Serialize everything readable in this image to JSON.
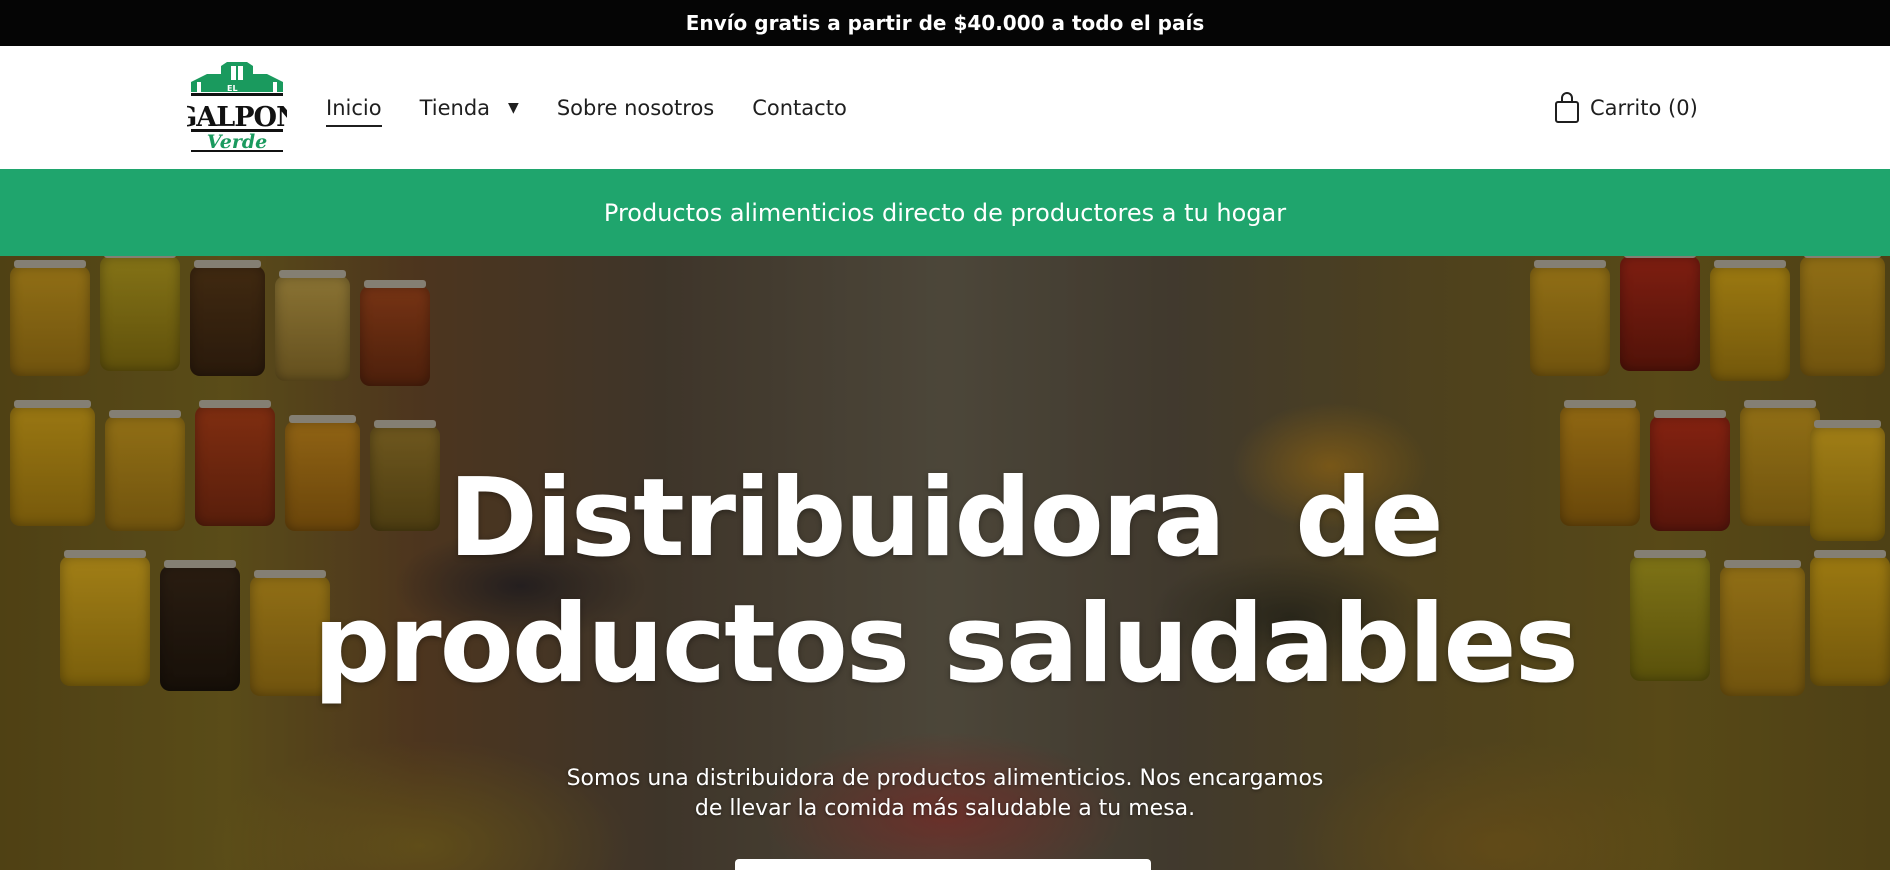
{
  "topbar": {
    "text": "Envío gratis a partir de $40.000 a todo el país"
  },
  "header": {
    "logo": {
      "line1": "EL",
      "line2": "GALPON",
      "line3": "Verde"
    },
    "nav": [
      {
        "label": "Inicio",
        "active": true
      },
      {
        "label": "Tienda",
        "has_dropdown": true,
        "dropdown_icon": "caret-down-icon"
      },
      {
        "label": "Sobre nosotros"
      },
      {
        "label": "Contacto"
      }
    ],
    "cart": {
      "label": "Carrito (0)",
      "icon": "shopping-bag-icon"
    }
  },
  "banner": {
    "text": "Productos alimenticios directo de productores a tu hogar"
  },
  "hero": {
    "title_line1": "Distribuidora  de",
    "title_line2": "productos saludables",
    "subtitle_line1": "Somos una distribuidora de productos alimenticios. Nos encargamos",
    "subtitle_line2": "de llevar la comida más saludable a tu mesa."
  },
  "colors": {
    "topbar_bg": "#050505",
    "banner_bg": "#1fa56d",
    "logo_green": "#1a9a5e",
    "text_dark": "#1f1f1f"
  }
}
